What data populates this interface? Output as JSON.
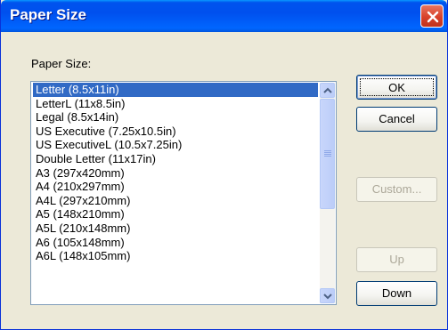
{
  "window": {
    "title": "Paper Size",
    "close_icon": "close-icon"
  },
  "paper_size": {
    "label": "Paper Size:",
    "selected_index": 0,
    "items": [
      "Letter (8.5x11in)",
      "LetterL (11x8.5in)",
      "Legal (8.5x14in)",
      "US Executive (7.25x10.5in)",
      "US ExecutiveL (10.5x7.25in)",
      "Double Letter (11x17in)",
      "A3 (297x420mm)",
      "A4 (210x297mm)",
      "A4L (297x210mm)",
      "A5 (148x210mm)",
      "A5L (210x148mm)",
      "A6 (105x148mm)",
      "A6L (148x105mm)"
    ]
  },
  "buttons": {
    "ok": "OK",
    "cancel": "Cancel",
    "custom": "Custom...",
    "up": "Up",
    "down": "Down"
  },
  "colors": {
    "selection": "#316ac5",
    "titlebar": "#0053ee",
    "dialog_bg": "#ece9d8"
  }
}
